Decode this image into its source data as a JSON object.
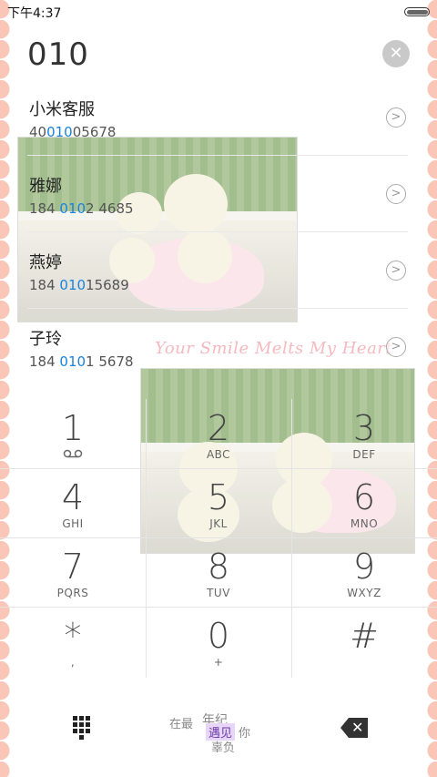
{
  "status_bar": {
    "time": "下午4:37"
  },
  "dialer": {
    "number": "010"
  },
  "contacts": [
    {
      "name": "小米客服",
      "num_pre": "40",
      "num_match": "010",
      "num_post": "05678"
    },
    {
      "name": "雅娜",
      "num_pre": "184 ",
      "num_match": "010",
      "num_post": "2 4685"
    },
    {
      "name": "燕婷",
      "num_pre": "184 ",
      "num_match": "010",
      "num_post": "15689"
    },
    {
      "name": "子玲",
      "num_pre": "184 ",
      "num_match": "010",
      "num_post": "1 5678"
    }
  ],
  "decor": {
    "script_text": "Your Smile Melts My Heart",
    "bottom_text": {
      "a": "在最",
      "b": "年纪",
      "c": "遇见",
      "d": "你",
      "e": "辜负"
    }
  },
  "keypad": {
    "keys": [
      {
        "digit": "1",
        "letters": ""
      },
      {
        "digit": "2",
        "letters": "ABC"
      },
      {
        "digit": "3",
        "letters": "DEF"
      },
      {
        "digit": "4",
        "letters": "GHI"
      },
      {
        "digit": "5",
        "letters": "JKL"
      },
      {
        "digit": "6",
        "letters": "MNO"
      },
      {
        "digit": "7",
        "letters": "PQRS"
      },
      {
        "digit": "8",
        "letters": "TUV"
      },
      {
        "digit": "9",
        "letters": "WXYZ"
      },
      {
        "digit": "*",
        "letters": ","
      },
      {
        "digit": "0",
        "letters": "+"
      },
      {
        "digit": "#",
        "letters": ""
      }
    ]
  },
  "colors": {
    "match_highlight": "#1a82dc",
    "border_pink": "#f9c6b8"
  },
  "icons": {
    "voicemail": "voicemail-icon",
    "clear": "clear-x-icon",
    "arrow": "chevron-right-circle-icon",
    "keypad": "keypad-grid-icon",
    "delete": "backspace-icon"
  }
}
